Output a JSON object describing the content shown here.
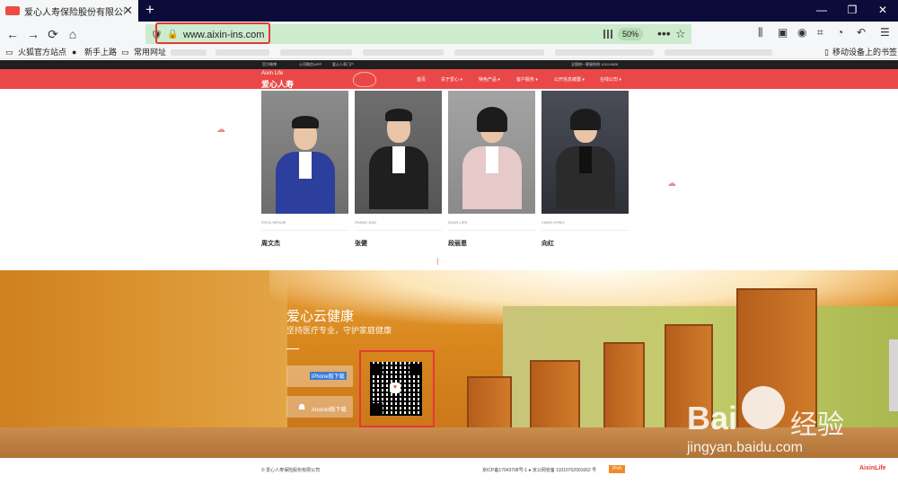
{
  "browser": {
    "tab_title": "爱心人寿保险股份有限公司",
    "tab_close": "✕",
    "new_tab": "+",
    "url": "www.aixin-ins.com",
    "zoom": "50%",
    "menu_dots": "•••",
    "bookmarks": [
      "火狐官方站点",
      "新手上路",
      "常用网址",
      "移动设备上的书签"
    ],
    "win_controls": [
      "—",
      "❐",
      "✕"
    ]
  },
  "site": {
    "topbar_links": [
      "官方微博",
      "公司微信/APP",
      "爱心人寿门户",
      "全国统一客服热线 1010-8626"
    ],
    "logo_en": "Aixin Life",
    "logo_cn": "爱心人寿",
    "nav": [
      "首页",
      "关于爱心 ▾",
      "特色产品 ▾",
      "客户服务 ▾",
      "公开信息披露 ▾",
      "在线公司 ▾"
    ],
    "team": [
      {
        "name": "周文杰",
        "en": "ZHOU WENJIE"
      },
      {
        "name": "张健",
        "en": "ZHANG JIAN"
      },
      {
        "name": "段丽恩",
        "en": "DUAN LIEN"
      },
      {
        "name": "向红",
        "en": "XIANG HONG"
      }
    ],
    "hero": {
      "title": "爱心云健康",
      "subtitle": "坚持医疗专业，守护家庭健康",
      "iphone_label": "iPhone版下载",
      "android_label": "Android版下载"
    },
    "footer": {
      "copyright": "© 爱心人寿保险股份有限公司",
      "icp": "京ICP备17043708号-1 ● 京公网安备 11010702001662 号",
      "ipv6": "IPv6",
      "logo": "AixinLife"
    }
  },
  "watermark": {
    "bai": "Bai",
    "jingyan": "经验",
    "url": "jingyan.baidu.com"
  }
}
